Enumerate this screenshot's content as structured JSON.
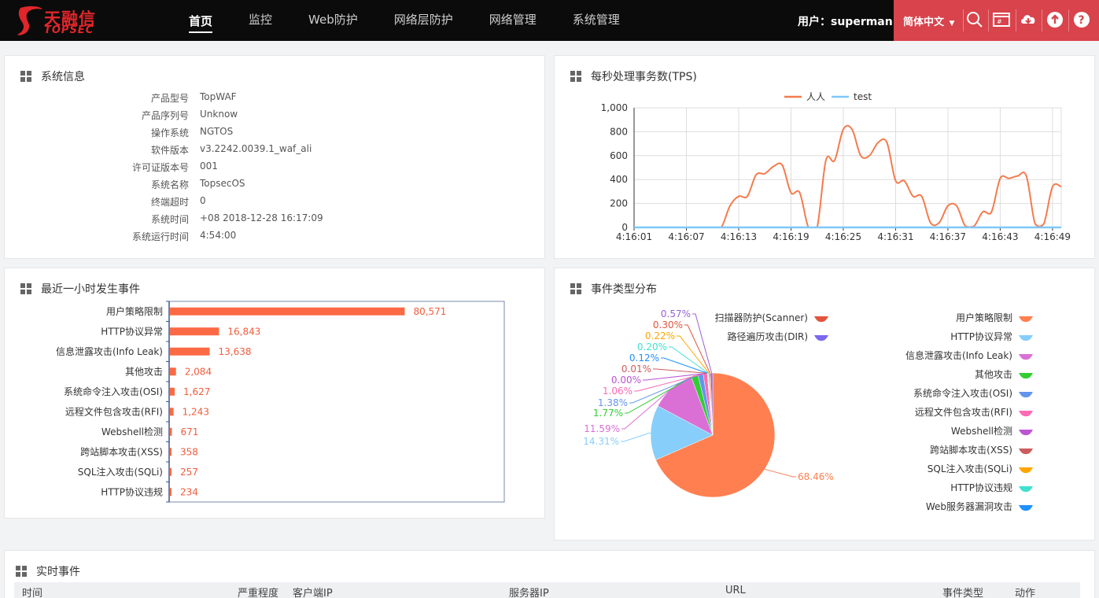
{
  "brand": {
    "cn": "天融信",
    "en": "TOPSEC"
  },
  "nav": [
    "首页",
    "监控",
    "Web防护",
    "网络层防护",
    "网络管理",
    "系统管理"
  ],
  "user": {
    "label": "用户：",
    "name": "superman"
  },
  "lang": "简体中文",
  "icons": [
    "search-icon",
    "monitor-icon",
    "download-icon",
    "upload-icon",
    "help-icon"
  ],
  "sysinfo": {
    "title": "系统信息",
    "rows": [
      {
        "k": "产品型号",
        "v": "TopWAF"
      },
      {
        "k": "产品序列号",
        "v": "Unknow"
      },
      {
        "k": "操作系统",
        "v": "NGTOS"
      },
      {
        "k": "软件版本",
        "v": "v3.2242.0039.1_waf_ali"
      },
      {
        "k": "许可证版本号",
        "v": "001"
      },
      {
        "k": "系统名称",
        "v": "TopsecOS"
      },
      {
        "k": "终端超时",
        "v": "0"
      },
      {
        "k": "系统时间",
        "v": "+08 2018-12-28 16:17:09"
      },
      {
        "k": "系统运行时间",
        "v": "4:54:00"
      }
    ]
  },
  "tps": {
    "title": "每秒处理事务数(TPS)",
    "chart_data": {
      "type": "line",
      "x": [
        "4:16:01",
        "4:16:02",
        "4:16:03",
        "4:16:04",
        "4:16:05",
        "4:16:06",
        "4:16:07",
        "4:16:08",
        "4:16:09",
        "4:16:10",
        "4:16:11",
        "4:16:12",
        "4:16:13",
        "4:16:14",
        "4:16:15",
        "4:16:16",
        "4:16:17",
        "4:16:18",
        "4:16:19",
        "4:16:20",
        "4:16:21",
        "4:16:22",
        "4:16:23",
        "4:16:24",
        "4:16:25",
        "4:16:26",
        "4:16:27",
        "4:16:28",
        "4:16:29",
        "4:16:30",
        "4:16:31",
        "4:16:32",
        "4:16:33",
        "4:16:34",
        "4:16:35",
        "4:16:36",
        "4:16:37",
        "4:16:38",
        "4:16:39",
        "4:16:40",
        "4:16:41",
        "4:16:42",
        "4:16:43",
        "4:16:44",
        "4:16:45",
        "4:16:46",
        "4:16:47",
        "4:16:48",
        "4:16:49",
        "4:16:50"
      ],
      "xticks": [
        "4:16:01",
        "4:16:07",
        "4:16:13",
        "4:16:19",
        "4:16:25",
        "4:16:31",
        "4:16:37",
        "4:16:43",
        "4:16:49"
      ],
      "yticks": [
        "0",
        "200",
        "400",
        "600",
        "800",
        "1,000"
      ],
      "ylim": [
        0,
        1000
      ],
      "legend": "top-center",
      "series": [
        {
          "name": "人人",
          "color": "#f47b4d",
          "values": [
            0,
            0,
            0,
            0,
            0,
            0,
            0,
            0,
            0,
            0,
            0,
            180,
            260,
            260,
            440,
            450,
            510,
            520,
            290,
            290,
            0,
            0,
            560,
            560,
            820,
            820,
            600,
            600,
            710,
            710,
            390,
            390,
            260,
            260,
            40,
            40,
            180,
            180,
            10,
            10,
            130,
            130,
            410,
            410,
            430,
            430,
            30,
            30,
            340,
            340
          ]
        },
        {
          "name": "test",
          "color": "#7fc8f8",
          "values": [
            0,
            0,
            0,
            0,
            0,
            0,
            0,
            0,
            0,
            0,
            0,
            0,
            0,
            0,
            0,
            0,
            0,
            0,
            0,
            0,
            0,
            0,
            0,
            0,
            0,
            0,
            0,
            0,
            0,
            0,
            0,
            0,
            0,
            0,
            0,
            0,
            0,
            0,
            0,
            0,
            0,
            0,
            0,
            0,
            0,
            0,
            0,
            0,
            0,
            0
          ]
        }
      ]
    }
  },
  "events": {
    "title": "最近一小时发生事件",
    "chart_data": {
      "type": "bar",
      "orientation": "horizontal",
      "categories": [
        "用户策略限制",
        "HTTP协议异常",
        "信息泄露攻击(Info Leak)",
        "其他攻击",
        "系统命令注入攻击(OSI)",
        "远程文件包含攻击(RFI)",
        "Webshell检测",
        "跨站脚本攻击(XSS)",
        "SQL注入攻击(SQLi)",
        "HTTP协议违规"
      ],
      "values": [
        80571,
        16843,
        13638,
        2084,
        1627,
        1243,
        671,
        358,
        257,
        234
      ],
      "labels": [
        "80,571",
        "16,843",
        "13,638",
        "2,084",
        "1,627",
        "1,243",
        "671",
        "358",
        "257",
        "234"
      ],
      "xlim": [
        0,
        115000
      ],
      "color": "#fb6a45"
    }
  },
  "dist": {
    "title": "事件类型分布",
    "chart_data": {
      "type": "pie",
      "slices": [
        {
          "name": "用户策略限制",
          "value": 68.46,
          "label": "68.46%",
          "color": "#ff7f50"
        },
        {
          "name": "HTTP协议异常",
          "value": 14.31,
          "label": "14.31%",
          "color": "#87cefa"
        },
        {
          "name": "信息泄露攻击(Info Leak)",
          "value": 11.59,
          "label": "11.59%",
          "color": "#da70d6"
        },
        {
          "name": "其他攻击",
          "value": 1.77,
          "label": "1.77%",
          "color": "#32cd32"
        },
        {
          "name": "系统命令注入攻击(OSI)",
          "value": 1.38,
          "label": "1.38%",
          "color": "#6495ed"
        },
        {
          "name": "远程文件包含攻击(RFI)",
          "value": 1.06,
          "label": "1.06%",
          "color": "#ff69b4"
        },
        {
          "name": "Webshell检测",
          "value": 0.0,
          "label": "0.00%",
          "color": "#ba55d3"
        },
        {
          "name": "跨站脚本攻击(XSS)",
          "value": 0.01,
          "label": "0.01%",
          "color": "#cd5c5c"
        },
        {
          "name": "Web服务器漏洞攻击",
          "value": 0.12,
          "label": "0.12%",
          "color": "#1e90ff"
        },
        {
          "name": "HTTP协议违规",
          "value": 0.2,
          "label": "0.20%",
          "color": "#40e0d0"
        },
        {
          "name": "SQL注入攻击(SQLi)",
          "value": 0.22,
          "label": "0.22%",
          "color": "#ffa500"
        },
        {
          "name": "路径遍历攻击(DIR)",
          "value": 0.3,
          "label": "0.30%",
          "color": "#e2543b"
        },
        {
          "name": "扫描器防护(Scanner)",
          "value": 0.57,
          "label": "0.57%",
          "color": "#9a60d4"
        }
      ],
      "legend_left": [
        {
          "name": "扫描器防护(Scanner)",
          "color": "#e2543b"
        },
        {
          "name": "路径遍历攻击(DIR)",
          "color": "#7b68ee"
        }
      ],
      "legend_right": [
        {
          "name": "用户策略限制",
          "color": "#ff7f50"
        },
        {
          "name": "HTTP协议异常",
          "color": "#87cefa"
        },
        {
          "name": "信息泄露攻击(Info Leak)",
          "color": "#da70d6"
        },
        {
          "name": "其他攻击",
          "color": "#32cd32"
        },
        {
          "name": "系统命令注入攻击(OSI)",
          "color": "#6495ed"
        },
        {
          "name": "远程文件包含攻击(RFI)",
          "color": "#ff69b4"
        },
        {
          "name": "Webshell检测",
          "color": "#ba55d3"
        },
        {
          "name": "跨站脚本攻击(XSS)",
          "color": "#cd5c5c"
        },
        {
          "name": "SQL注入攻击(SQLi)",
          "color": "#ffa500"
        },
        {
          "name": "HTTP协议违规",
          "color": "#40e0d0"
        },
        {
          "name": "Web服务器漏洞攻击",
          "color": "#1e90ff"
        }
      ]
    }
  },
  "realtime": {
    "title": "实时事件",
    "columns": [
      "时间",
      "严重程度",
      "客户端IP",
      "服务器IP",
      "URL",
      "事件类型",
      "动作"
    ]
  }
}
